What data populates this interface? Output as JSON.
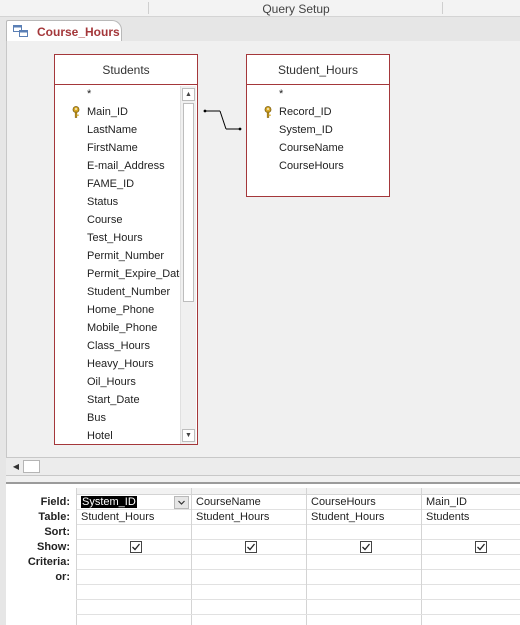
{
  "ribbon": {
    "group_label": "Query Setup"
  },
  "document_tab": {
    "label": "Course_Hours",
    "icon": "query-icon"
  },
  "tables": [
    {
      "name": "Students",
      "primary_key_icon": "key-icon",
      "fields": [
        "*",
        "Main_ID",
        "LastName",
        "FirstName",
        "E-mail_Address",
        "FAME_ID",
        "Status",
        "Course",
        "Test_Hours",
        "Permit_Number",
        "Permit_Expire_Date",
        "Student_Number",
        "Home_Phone",
        "Mobile_Phone",
        "Class_Hours",
        "Heavy_Hours",
        "Oil_Hours",
        "Start_Date",
        "Bus",
        "Hotel"
      ]
    },
    {
      "name": "Student_Hours",
      "primary_key_icon": "key-icon",
      "fields": [
        "*",
        "Record_ID",
        "System_ID",
        "CourseName",
        "CourseHours"
      ]
    }
  ],
  "grid": {
    "row_labels": [
      "Field:",
      "Table:",
      "Sort:",
      "Show:",
      "Criteria:",
      "or:"
    ],
    "columns": [
      {
        "field": "System_ID",
        "table": "Student_Hours",
        "sort": "",
        "show": true,
        "criteria": "",
        "or": ""
      },
      {
        "field": "CourseName",
        "table": "Student_Hours",
        "sort": "",
        "show": true,
        "criteria": "",
        "or": ""
      },
      {
        "field": "CourseHours",
        "table": "Student_Hours",
        "sort": "",
        "show": true,
        "criteria": "",
        "or": ""
      },
      {
        "field": "Main_ID",
        "table": "Students",
        "sort": "",
        "show": true,
        "criteria": "",
        "or": ""
      }
    ]
  },
  "colors": {
    "accent": "#a4373a",
    "grid_line": "#d4d4d4"
  }
}
